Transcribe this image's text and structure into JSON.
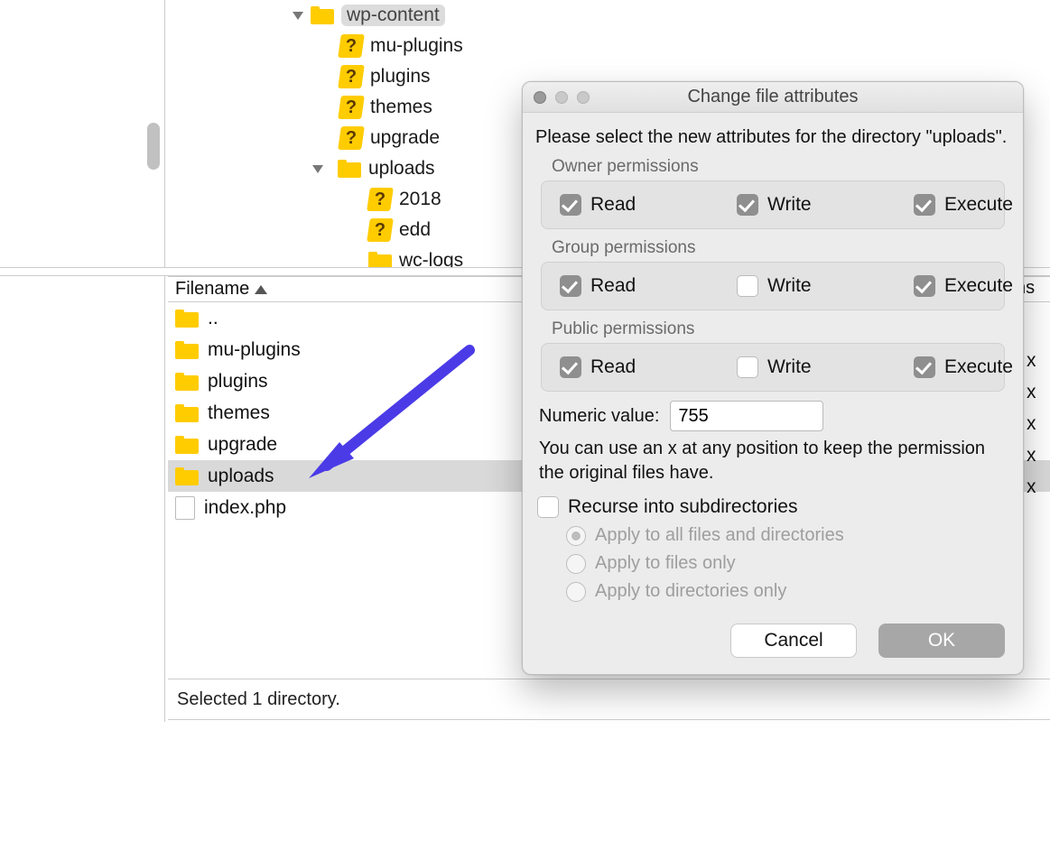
{
  "tree": {
    "root_label": "wp-content",
    "items": [
      {
        "icon": "q",
        "label": "mu-plugins",
        "indent": 1
      },
      {
        "icon": "q",
        "label": "plugins",
        "indent": 1
      },
      {
        "icon": "q",
        "label": "themes",
        "indent": 1
      },
      {
        "icon": "q",
        "label": "upgrade",
        "indent": 1
      },
      {
        "icon": "folder",
        "label": "uploads",
        "indent": 1,
        "disclosure": true
      },
      {
        "icon": "q",
        "label": "2018",
        "indent": 2
      },
      {
        "icon": "q",
        "label": "edd",
        "indent": 2
      },
      {
        "icon": "folder",
        "label": "wc-logs",
        "indent": 2
      }
    ]
  },
  "list": {
    "header": "Filename",
    "rows": [
      {
        "icon": "folder",
        "label": ".."
      },
      {
        "icon": "folder",
        "label": "mu-plugins"
      },
      {
        "icon": "folder",
        "label": "plugins"
      },
      {
        "icon": "folder",
        "label": "themes"
      },
      {
        "icon": "folder",
        "label": "upgrade"
      },
      {
        "icon": "folder",
        "label": "uploads",
        "selected": true
      },
      {
        "icon": "file",
        "label": "index.php"
      }
    ],
    "ghost_header": "ns",
    "ghost_suffix": "x"
  },
  "status": "Selected 1 directory.",
  "dialog": {
    "title": "Change file attributes",
    "intro": "Please select the new attributes for the directory \"uploads\".",
    "groups": {
      "owner": {
        "label": "Owner permissions",
        "read": true,
        "write": true,
        "execute": true
      },
      "group": {
        "label": "Group permissions",
        "read": true,
        "write": false,
        "execute": true
      },
      "public": {
        "label": "Public permissions",
        "read": true,
        "write": false,
        "execute": true
      }
    },
    "perm_labels": {
      "read": "Read",
      "write": "Write",
      "execute": "Execute"
    },
    "numeric_label": "Numeric value:",
    "numeric_value": "755",
    "hint": "You can use an x at any position to keep the permission the original files have.",
    "recurse_label": "Recurse into subdirectories",
    "radio": {
      "all": "Apply to all files and directories",
      "files": "Apply to files only",
      "dirs": "Apply to directories only"
    },
    "buttons": {
      "cancel": "Cancel",
      "ok": "OK"
    }
  }
}
